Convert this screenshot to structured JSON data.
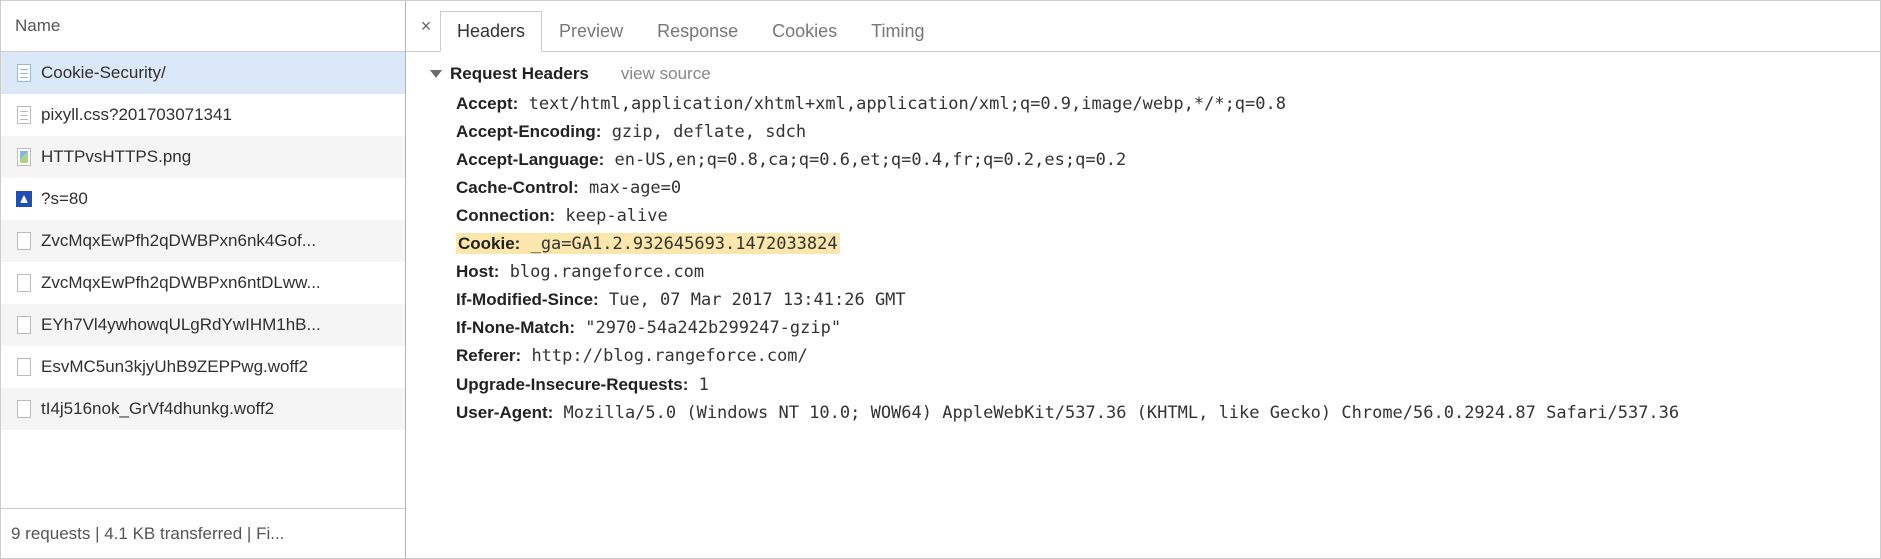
{
  "left_header": "Name",
  "requests": [
    {
      "name": "Cookie-Security/",
      "iconType": "doc",
      "selected": true
    },
    {
      "name": "pixyll.css?201703071341",
      "iconType": "css",
      "selected": false
    },
    {
      "name": "HTTPvsHTTPS.png",
      "iconType": "img",
      "selected": false
    },
    {
      "name": "?s=80",
      "iconType": "avatar",
      "selected": false
    },
    {
      "name": "ZvcMqxEwPfh2qDWBPxn6nk4Gof...",
      "iconType": "blank",
      "selected": false
    },
    {
      "name": "ZvcMqxEwPfh2qDWBPxn6ntDLww...",
      "iconType": "blank",
      "selected": false
    },
    {
      "name": "EYh7Vl4ywhowqULgRdYwIHM1hB...",
      "iconType": "blank",
      "selected": false
    },
    {
      "name": "EsvMC5un3kjyUhB9ZEPPwg.woff2",
      "iconType": "blank",
      "selected": false
    },
    {
      "name": "tI4j516nok_GrVf4dhunkg.woff2",
      "iconType": "blank",
      "selected": false
    }
  ],
  "footer_text": "9 requests  |  4.1 KB transferred  |  Fi...",
  "tabs": [
    {
      "id": "headers",
      "label": "Headers",
      "active": true
    },
    {
      "id": "preview",
      "label": "Preview",
      "active": false
    },
    {
      "id": "response",
      "label": "Response",
      "active": false
    },
    {
      "id": "cookies",
      "label": "Cookies",
      "active": false
    },
    {
      "id": "timing",
      "label": "Timing",
      "active": false
    }
  ],
  "close_glyph": "×",
  "section_title": "Request Headers",
  "view_source_label": "view source",
  "headers": [
    {
      "name": "Accept:",
      "value": "text/html,application/xhtml+xml,application/xml;q=0.9,image/webp,*/*;q=0.8",
      "highlight": false
    },
    {
      "name": "Accept-Encoding:",
      "value": "gzip, deflate, sdch",
      "highlight": false
    },
    {
      "name": "Accept-Language:",
      "value": "en-US,en;q=0.8,ca;q=0.6,et;q=0.4,fr;q=0.2,es;q=0.2",
      "highlight": false
    },
    {
      "name": "Cache-Control:",
      "value": "max-age=0",
      "highlight": false
    },
    {
      "name": "Connection:",
      "value": "keep-alive",
      "highlight": false
    },
    {
      "name": "Cookie:",
      "value": "_ga=GA1.2.932645693.1472033824",
      "highlight": true
    },
    {
      "name": "Host:",
      "value": "blog.rangeforce.com",
      "highlight": false
    },
    {
      "name": "If-Modified-Since:",
      "value": "Tue, 07 Mar 2017 13:41:26 GMT",
      "highlight": false
    },
    {
      "name": "If-None-Match:",
      "value": "\"2970-54a242b299247-gzip\"",
      "highlight": false
    },
    {
      "name": "Referer:",
      "value": "http://blog.rangeforce.com/",
      "highlight": false
    },
    {
      "name": "Upgrade-Insecure-Requests:",
      "value": "1",
      "highlight": false
    },
    {
      "name": "User-Agent:",
      "value": "Mozilla/5.0 (Windows NT 10.0; WOW64) AppleWebKit/537.36 (KHTML, like Gecko) Chrome/56.0.2924.87 Safari/537.36",
      "highlight": false
    }
  ]
}
